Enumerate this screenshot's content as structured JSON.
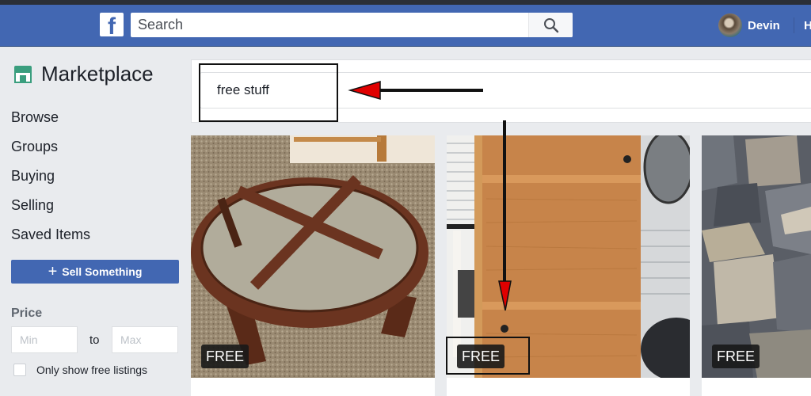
{
  "header": {
    "logo_letter": "f",
    "search_placeholder": "Search",
    "search_value": "",
    "user_name": "Devin",
    "nav_home_partial": "H"
  },
  "sidebar": {
    "title": "Marketplace",
    "nav_items": [
      {
        "label": "Browse"
      },
      {
        "label": "Groups"
      },
      {
        "label": "Buying"
      },
      {
        "label": "Selling"
      },
      {
        "label": "Saved Items"
      }
    ],
    "sell_button": {
      "icon": "+",
      "label": "Sell Something"
    },
    "price": {
      "label": "Price",
      "min_placeholder": "Min",
      "max_placeholder": "Max",
      "separator": "to"
    },
    "free_only": {
      "label": "Only show free listings",
      "checked": false
    }
  },
  "main": {
    "query_value": "free stuff",
    "listings": [
      {
        "subject": "round glass coffee table",
        "price": "FREE"
      },
      {
        "subject": "oak wood cabinet door",
        "price": "FREE"
      },
      {
        "subject": "pile of stone blocks",
        "price": "FREE"
      }
    ]
  },
  "colors": {
    "brand_blue": "#4267b2",
    "page_bg": "#e9ebee",
    "annotation_arrow": "#e00000"
  }
}
